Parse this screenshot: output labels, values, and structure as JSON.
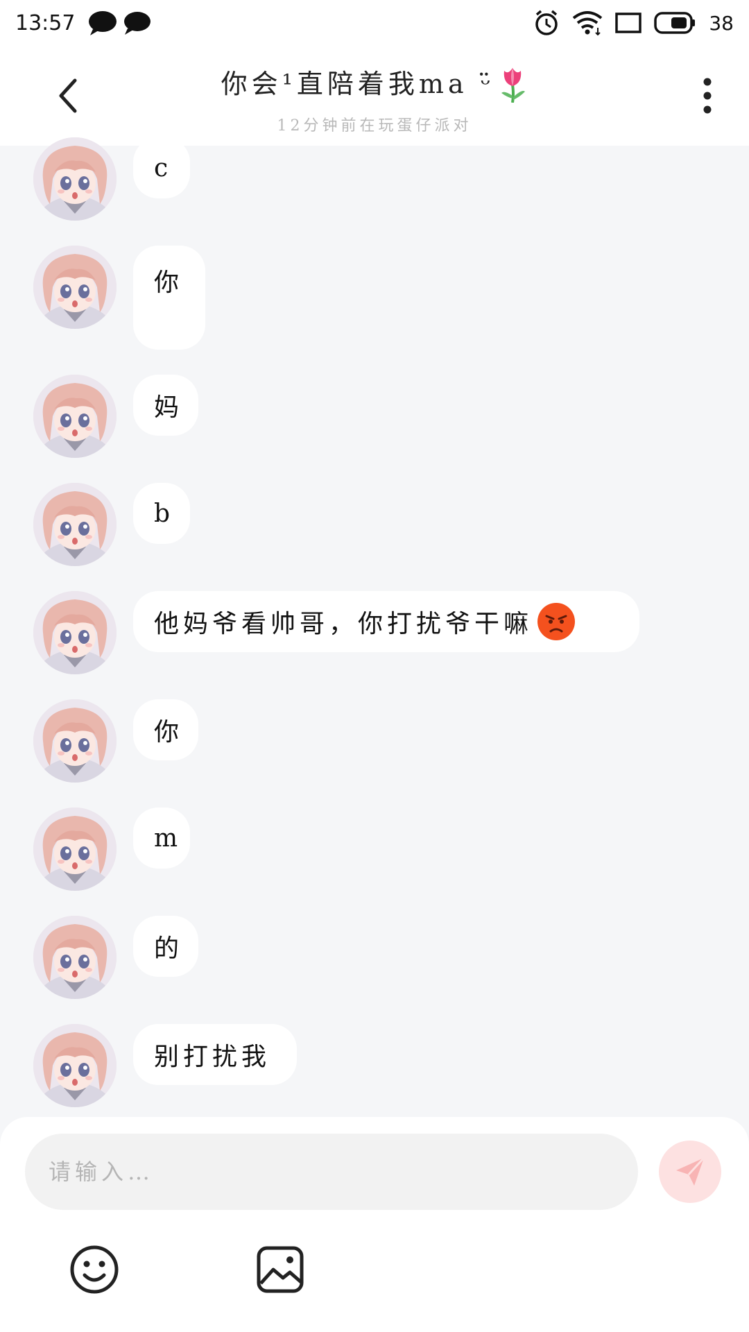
{
  "status_bar": {
    "time": "13:57",
    "battery": "38"
  },
  "header": {
    "title": "你会¹直陪着我ma ᵕ̈",
    "subtitle": "12分钟前在玩蛋仔派对"
  },
  "messages": [
    {
      "text": "c"
    },
    {
      "text": "你"
    },
    {
      "text": "妈"
    },
    {
      "text": "b"
    },
    {
      "text": "他妈爷看帅哥，你打扰爷干嘛"
    },
    {
      "text": "你"
    },
    {
      "text": "m"
    },
    {
      "text": "的"
    },
    {
      "text": "别打扰我"
    }
  ],
  "composer": {
    "placeholder": "请输入…"
  },
  "colors": {
    "background": "#f5f6f8",
    "bubble": "#ffffff",
    "send_button": "#fde1e1",
    "send_icon": "#f8b4b4"
  },
  "icons": {
    "back": "chevron-left-icon",
    "more": "more-vertical-icon",
    "send": "send-icon",
    "emoji": "smiley-icon",
    "image": "image-icon",
    "title_decoration": "tulip-icon",
    "angry_emoji": "angry-face-icon"
  }
}
